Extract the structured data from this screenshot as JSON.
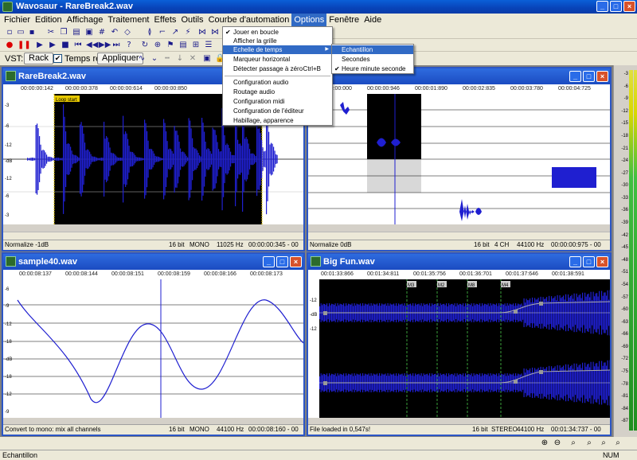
{
  "app": {
    "title": "Wavosaur - RareBreak2.wav"
  },
  "menu": [
    "Fichier",
    "Edition",
    "Affichage",
    "Traitement",
    "Effets",
    "Outils",
    "Courbe d'automation",
    "Options",
    "Fenêtre",
    "Aide"
  ],
  "options_menu": {
    "items": [
      "Jouer en boucle",
      "Afficher la grille",
      "Echelle de temps",
      "Marqueur horizontal",
      "Détecter passage à zéro",
      "Configuration audio",
      "Routage audio",
      "Configuration midi",
      "Configuration de l'éditeur",
      "Habillage, apparence"
    ],
    "shortcut_zero": "Ctrl+B",
    "check": "✔",
    "arrow": "▶"
  },
  "time_scale_submenu": {
    "items": [
      "Echantillon",
      "Secondes",
      "Heure minute seconde"
    ]
  },
  "vst": {
    "label": "VST:",
    "rack": "Rack",
    "realtime": "Temps réel",
    "apply": "Appliquer"
  },
  "windows": {
    "w1": {
      "title": "RareBreak2.wav",
      "ruler": [
        "00:00:00:142",
        "00:00:00:378",
        "00:00:00:614",
        "00:00:00:850"
      ],
      "loop": "Loop start",
      "db": [
        "-3",
        "-6",
        "-12",
        "-dB",
        "-12",
        "-6",
        "-3"
      ],
      "status": [
        "Normalize -1dB",
        "16 bit",
        "MONO",
        "11025 Hz",
        "00:00:00:345 - 00"
      ]
    },
    "w2": {
      "title": "",
      "ruler": [
        "00:00:00:000",
        "00:00:00:946",
        "00:00:01:890",
        "00:00:02:835",
        "00:00:03:780",
        "00:00:04:725"
      ],
      "status": [
        "Normalize 0dB",
        "16 bit",
        "4 CH",
        "44100 Hz",
        "00:00:00:975 - 00"
      ]
    },
    "w3": {
      "title": "sample40.wav",
      "ruler": [
        "00:00:08:137",
        "00:00:08:144",
        "00:00:08:151",
        "00:00:08:159",
        "00:00:08:166",
        "00:00:08:173"
      ],
      "db": [
        "-6",
        "-9",
        "-12",
        "-18",
        "-dB",
        "-18",
        "-12",
        "-9"
      ],
      "status": [
        "Convert to mono: mix all channels",
        "16 bit",
        "MONO",
        "44100 Hz",
        "00:00:08:160 - 00"
      ]
    },
    "w4": {
      "title": "Big Fun.wav",
      "ruler": [
        "00:01:33:866",
        "00:01:34:811",
        "00:01:35:756",
        "00:01:36:701",
        "00:01:37:646",
        "00:01:38:591"
      ],
      "markers": [
        "M3",
        "M2",
        "M8",
        "M4"
      ],
      "db": [
        "-12",
        "-dB",
        "-12"
      ],
      "status": [
        "File loaded in 0,547s!",
        "16 bit",
        "STEREO",
        "44100 Hz",
        "00:01:34:737 - 00"
      ]
    }
  },
  "meter": {
    "scale": [
      "-3",
      "-6",
      "-9",
      "-12",
      "-15",
      "-18",
      "-21",
      "-24",
      "-27",
      "-30",
      "-33",
      "-36",
      "-39",
      "-42",
      "-45",
      "-48",
      "-51",
      "-54",
      "-57",
      "-60",
      "-63",
      "-66",
      "-69",
      "-72",
      "-75",
      "-78",
      "-81",
      "-84",
      "-87"
    ]
  },
  "statusbar": {
    "left": "Echantillon",
    "num": "NUM"
  },
  "colors": {
    "wave": "#1f1fd0",
    "wave_dark": "#000000",
    "wave_bg": "#ffffff",
    "accent": "#316ac5"
  }
}
